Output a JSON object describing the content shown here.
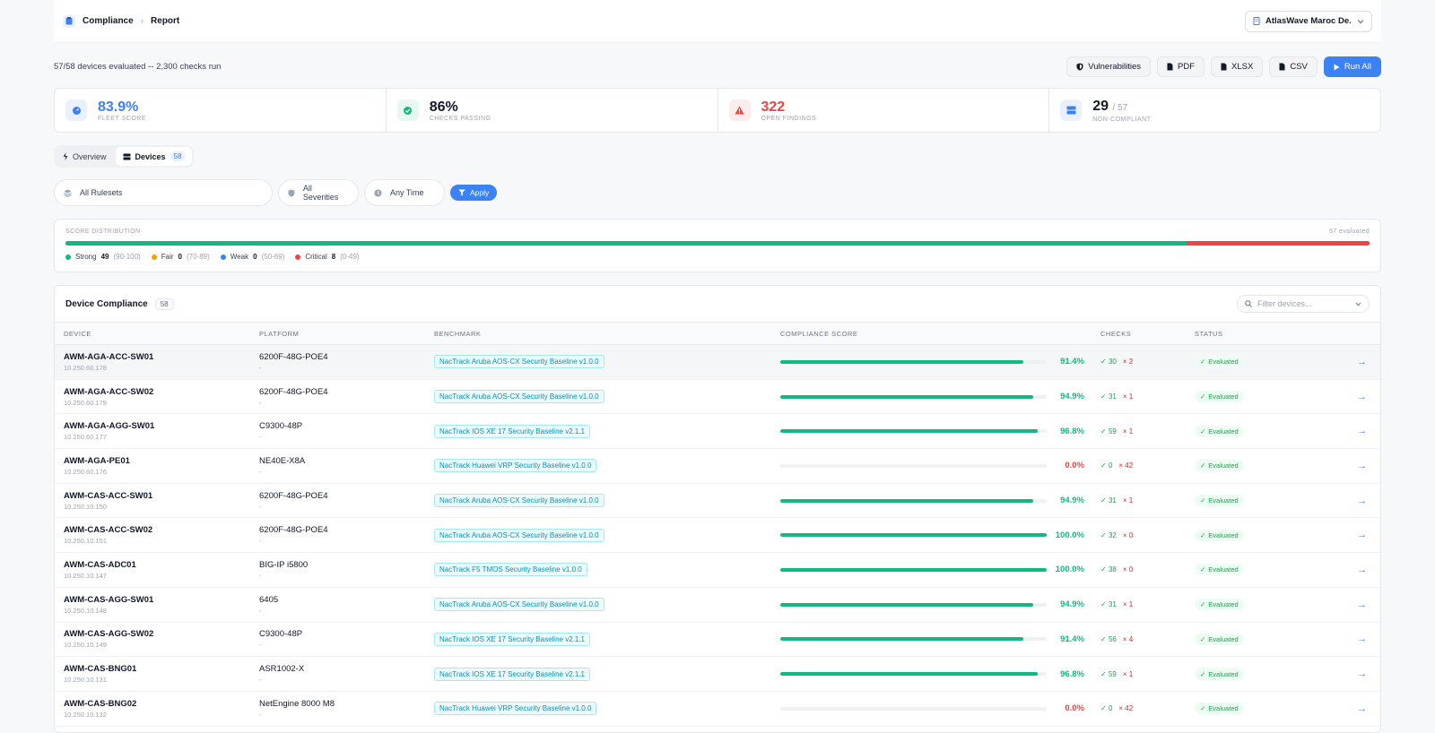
{
  "breadcrumb": {
    "parent": "Compliance",
    "current": "Report"
  },
  "org_selector": {
    "label": "AtlasWave Maroc De..."
  },
  "summary": "57/58 devices evaluated -- 2,300 checks run",
  "actions": {
    "vulnerabilities": "Vulnerabilities",
    "pdf": "PDF",
    "xlsx": "XLSX",
    "csv": "CSV",
    "run_all": "Run All"
  },
  "kpis": [
    {
      "value": "83.9%",
      "label": "FLEET SCORE",
      "color": "#3b82f6",
      "icon": "gauge-icon"
    },
    {
      "value": "86%",
      "label": "CHECKS PASSING",
      "color": "#111827",
      "icon": "check-circle-icon"
    },
    {
      "value": "322",
      "label": "OPEN FINDINGS",
      "color": "#ef4444",
      "icon": "warning-icon"
    },
    {
      "value": "29",
      "suffix": "/ 57",
      "label": "NON-COMPLIANT",
      "color": "#111827",
      "icon": "server-icon"
    }
  ],
  "tabs": [
    {
      "label": "Overview",
      "icon": "bolt-icon"
    },
    {
      "label": "Devices",
      "badge": "58",
      "icon": "server-icon"
    }
  ],
  "filters": {
    "ruleset": "All Rulesets",
    "severity": "All Severities",
    "time": "Any Time",
    "apply": "Apply"
  },
  "distribution": {
    "title": "SCORE DISTRIBUTION",
    "evaluated": "57 evaluated",
    "total": 57,
    "buckets": [
      {
        "label": "Strong",
        "count": 49,
        "range": "(90-100)",
        "color": "#10b981"
      },
      {
        "label": "Fair",
        "count": 0,
        "range": "(70-89)",
        "color": "#f59e0b"
      },
      {
        "label": "Weak",
        "count": 0,
        "range": "(50-69)",
        "color": "#3b82f6"
      },
      {
        "label": "Critical",
        "count": 8,
        "range": "(0-49)",
        "color": "#ef4444"
      }
    ]
  },
  "table": {
    "title": "Device Compliance",
    "count": "58",
    "filter_placeholder": "Filter devices...",
    "columns": [
      "DEVICE",
      "PLATFORM",
      "BENCHMARK",
      "COMPLIANCE SCORE",
      "CHECKS",
      "STATUS"
    ],
    "rows": [
      {
        "name": "AWM-AGA-ACC-SW01",
        "ip": "10.250.60.178",
        "platform": "6200F-48G-POE4",
        "sub": "-",
        "benchmark": "NacTrack Aruba AOS-CX Security Baseline v1.0.0",
        "score": 91.4,
        "score_text": "91.4%",
        "pass": "30",
        "fail": "2",
        "status": "Evaluated"
      },
      {
        "name": "AWM-AGA-ACC-SW02",
        "ip": "10.250.60.179",
        "platform": "6200F-48G-POE4",
        "sub": "-",
        "benchmark": "NacTrack Aruba AOS-CX Security Baseline v1.0.0",
        "score": 94.9,
        "score_text": "94.9%",
        "pass": "31",
        "fail": "1",
        "status": "Evaluated"
      },
      {
        "name": "AWM-AGA-AGG-SW01",
        "ip": "10.250.60.177",
        "platform": "C9300-48P",
        "sub": "-",
        "benchmark": "NacTrack IOS XE 17 Security Baseline v2.1.1",
        "score": 96.8,
        "score_text": "96.8%",
        "pass": "59",
        "fail": "1",
        "status": "Evaluated"
      },
      {
        "name": "AWM-AGA-PE01",
        "ip": "10.250.60.176",
        "platform": "NE40E-X8A",
        "sub": "-",
        "benchmark": "NacTrack Huawei VRP Security Baseline v1.0.0",
        "score": 0,
        "score_text": "0.0%",
        "pass": "0",
        "fail": "42",
        "status": "Evaluated"
      },
      {
        "name": "AWM-CAS-ACC-SW01",
        "ip": "10.250.10.150",
        "platform": "6200F-48G-POE4",
        "sub": "-",
        "benchmark": "NacTrack Aruba AOS-CX Security Baseline v1.0.0",
        "score": 94.9,
        "score_text": "94.9%",
        "pass": "31",
        "fail": "1",
        "status": "Evaluated"
      },
      {
        "name": "AWM-CAS-ACC-SW02",
        "ip": "10.250.10.151",
        "platform": "6200F-48G-POE4",
        "sub": "-",
        "benchmark": "NacTrack Aruba AOS-CX Security Baseline v1.0.0",
        "score": 100,
        "score_text": "100.0%",
        "pass": "32",
        "fail": "0",
        "status": "Evaluated"
      },
      {
        "name": "AWM-CAS-ADC01",
        "ip": "10.250.10.147",
        "platform": "BIG-IP i5800",
        "sub": "-",
        "benchmark": "NacTrack F5 TMOS Security Baseline v1.0.0",
        "score": 100,
        "score_text": "100.0%",
        "pass": "38",
        "fail": "0",
        "status": "Evaluated"
      },
      {
        "name": "AWM-CAS-AGG-SW01",
        "ip": "10.250.10.148",
        "platform": "6405",
        "sub": "-",
        "benchmark": "NacTrack Aruba AOS-CX Security Baseline v1.0.0",
        "score": 94.9,
        "score_text": "94.9%",
        "pass": "31",
        "fail": "1",
        "status": "Evaluated"
      },
      {
        "name": "AWM-CAS-AGG-SW02",
        "ip": "10.250.10.149",
        "platform": "C9300-48P",
        "sub": "-",
        "benchmark": "NacTrack IOS XE 17 Security Baseline v2.1.1",
        "score": 91.4,
        "score_text": "91.4%",
        "pass": "56",
        "fail": "4",
        "status": "Evaluated"
      },
      {
        "name": "AWM-CAS-BNG01",
        "ip": "10.250.10.131",
        "platform": "ASR1002-X",
        "sub": "-",
        "benchmark": "NacTrack IOS XE 17 Security Baseline v2.1.1",
        "score": 96.8,
        "score_text": "96.8%",
        "pass": "59",
        "fail": "1",
        "status": "Evaluated"
      },
      {
        "name": "AWM-CAS-BNG02",
        "ip": "10.250.10.132",
        "platform": "NetEngine 8000 M8",
        "sub": "-",
        "benchmark": "NacTrack Huawei VRP Security Baseline v1.0.0",
        "score": 0,
        "score_text": "0.0%",
        "pass": "0",
        "fail": "42",
        "status": "Evaluated"
      }
    ]
  },
  "colors": {
    "accent": "#3b82f6",
    "success": "#10b981",
    "danger": "#ef4444",
    "warning": "#f59e0b"
  }
}
